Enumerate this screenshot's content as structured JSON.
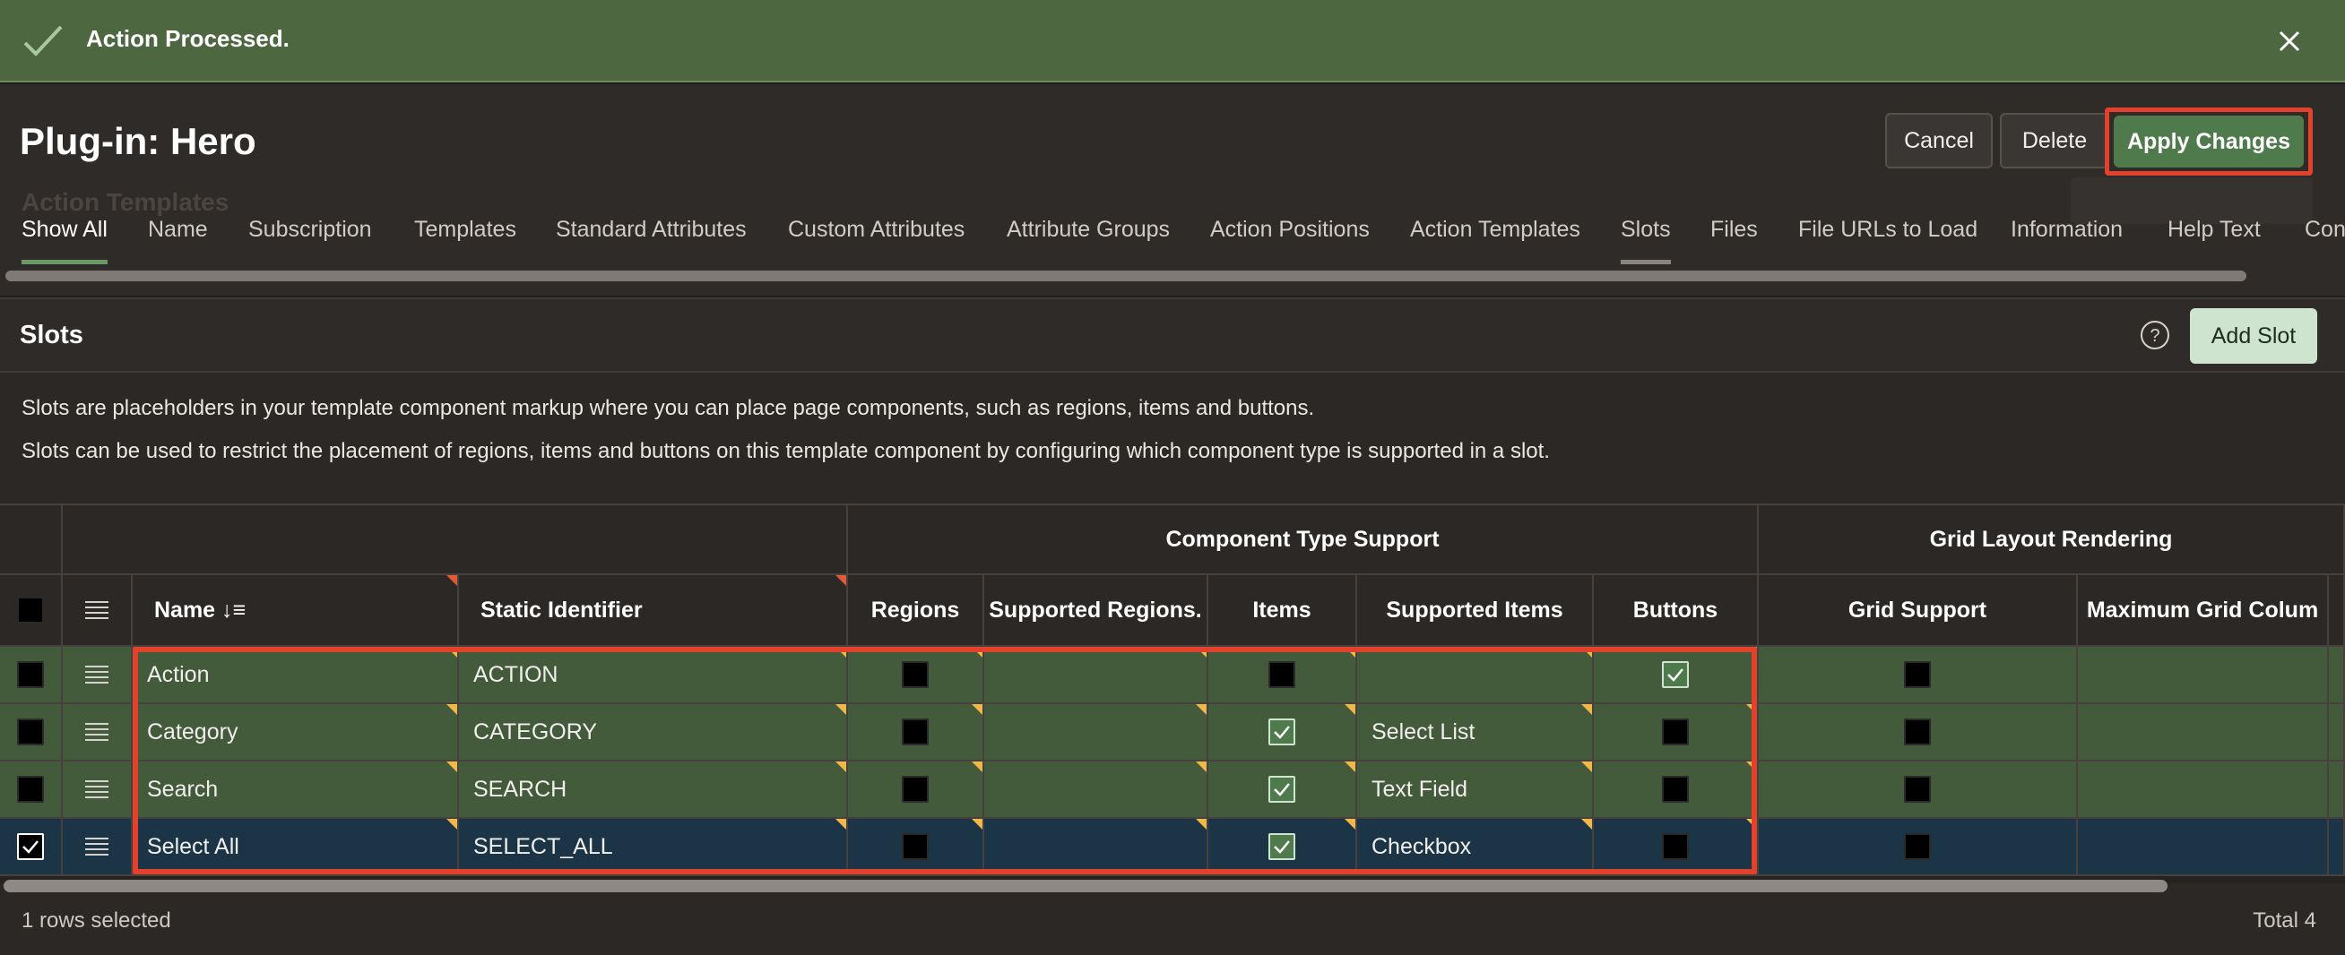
{
  "banner": {
    "message": "Action Processed."
  },
  "header": {
    "title": "Plug-in: Hero",
    "ghost_title": "Action Templates",
    "buttons": {
      "cancel": "Cancel",
      "delete": "Delete",
      "apply": "Apply Changes"
    }
  },
  "tabs": [
    "Show All",
    "Name",
    "Subscription",
    "Templates",
    "Standard Attributes",
    "Custom Attributes",
    "Attribute Groups",
    "Action Positions",
    "Action Templates",
    "Slots",
    "Files",
    "File URLs to Load",
    "Information",
    "Help Text",
    "Con"
  ],
  "active_tab": "Show All",
  "region": {
    "title": "Slots",
    "add_button": "Add Slot",
    "description_1": "Slots are placeholders in your template component markup where you can place page components, such as regions, items and buttons.",
    "description_2": "Slots can be used to restrict the placement of regions, items and buttons on this template component by configuring which component type is supported in a slot."
  },
  "grid": {
    "group_headers": {
      "component_type_support": "Component Type Support",
      "grid_layout_rendering": "Grid Layout Rendering"
    },
    "columns": {
      "name": "Name",
      "sort_indicator": "↓≡",
      "static_identifier": "Static Identifier",
      "regions": "Regions",
      "supported_regions": "Supported Regions.",
      "items": "Items",
      "supported_items": "Supported Items",
      "buttons": "Buttons",
      "grid_support": "Grid Support",
      "max_grid_columns": "Maximum Grid Colum"
    },
    "rows": [
      {
        "selected": false,
        "name": "Action",
        "static_id": "ACTION",
        "regions": false,
        "supported_regions": "",
        "items": false,
        "supported_items": "",
        "buttons": true,
        "grid_support": false,
        "max_grid_columns": ""
      },
      {
        "selected": false,
        "name": "Category",
        "static_id": "CATEGORY",
        "regions": false,
        "supported_regions": "",
        "items": true,
        "supported_items": "Select List",
        "buttons": false,
        "grid_support": false,
        "max_grid_columns": ""
      },
      {
        "selected": false,
        "name": "Search",
        "static_id": "SEARCH",
        "regions": false,
        "supported_regions": "",
        "items": true,
        "supported_items": "Text Field",
        "buttons": false,
        "grid_support": false,
        "max_grid_columns": ""
      },
      {
        "selected": true,
        "name": "Select All",
        "static_id": "SELECT_ALL",
        "regions": false,
        "supported_regions": "",
        "items": true,
        "supported_items": "Checkbox",
        "buttons": false,
        "grid_support": false,
        "max_grid_columns": ""
      }
    ],
    "footer_selected": "1 rows selected",
    "footer_total": "Total 4"
  },
  "colors": {
    "banner_green": "#4d6740",
    "row_green": "#435a3b",
    "row_selected": "#1c3546",
    "apply_green": "#4f7a4c",
    "highlight_red": "#e2412b",
    "add_slot_bg": "#cfe4cf"
  },
  "icons": [
    "check-icon",
    "close-icon",
    "help-icon",
    "row-menu-icon",
    "checkbox-icon"
  ]
}
